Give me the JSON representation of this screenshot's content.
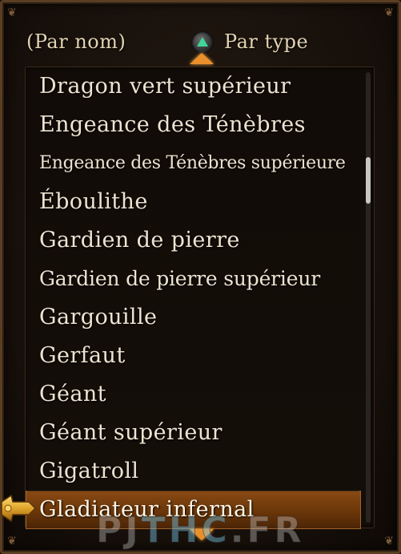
{
  "header": {
    "sort_by_name": "(Par nom)",
    "sort_by_type": "Par type"
  },
  "list": {
    "items": [
      "Dragon vert supérieur",
      "Engeance des Ténèbres",
      "Engeance des Ténèbres supérieure",
      "Éboulithe",
      "Gardien de pierre",
      "Gardien de pierre supérieur",
      "Gargouille",
      "Gerfaut",
      "Géant",
      "Géant supérieur",
      "Gigatroll",
      "Gladiateur infernal"
    ],
    "selected_index": 11
  },
  "scroll": {
    "position_fraction": 0.21
  },
  "watermark": {
    "left": "PJ",
    "middle": "THC",
    "right": ".FR"
  },
  "colors": {
    "accent": "#e9902c",
    "selected_row": "#6a3609",
    "text": "#ece4d2",
    "triangle": "#3fd69a"
  },
  "icons": {
    "triangle_button": "playstation-triangle-icon",
    "cursor": "pointing-hand-cursor-icon"
  }
}
